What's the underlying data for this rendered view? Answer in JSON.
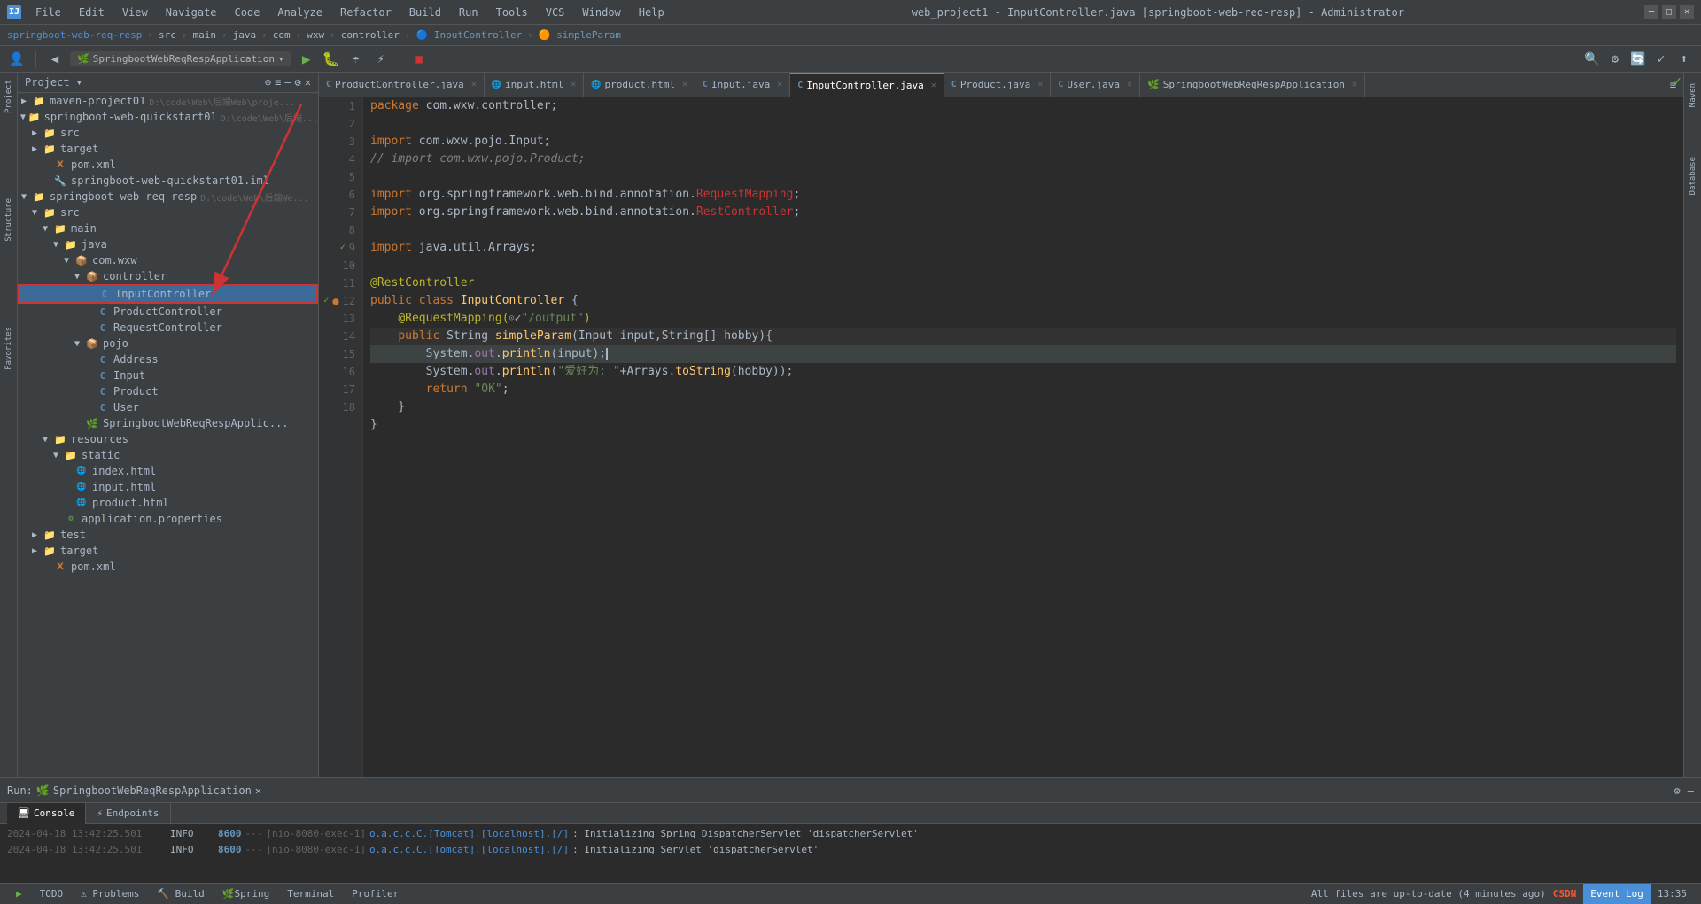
{
  "titlebar": {
    "app_icon": "IJ",
    "title": "web_project1 - InputController.java [springboot-web-req-resp] - Administrator",
    "menu": [
      "File",
      "Edit",
      "View",
      "Navigate",
      "Code",
      "Analyze",
      "Refactor",
      "Build",
      "Run",
      "Tools",
      "VCS",
      "Window",
      "Help"
    ]
  },
  "breadcrumb": {
    "items": [
      "springboot-web-req-resp",
      "src",
      "main",
      "java",
      "com",
      "wxw",
      "controller",
      "InputController",
      "simpleParam"
    ]
  },
  "tabs": [
    {
      "label": "ProductController.java",
      "type": "java",
      "active": false,
      "modified": false
    },
    {
      "label": "input.html",
      "type": "html",
      "active": false,
      "modified": false
    },
    {
      "label": "product.html",
      "type": "html",
      "active": false,
      "modified": false
    },
    {
      "label": "Input.java",
      "type": "java",
      "active": false,
      "modified": false
    },
    {
      "label": "InputController.java",
      "type": "java",
      "active": true,
      "modified": false
    },
    {
      "label": "Product.java",
      "type": "java",
      "active": false,
      "modified": false
    },
    {
      "label": "User.java",
      "type": "java",
      "active": false,
      "modified": false
    },
    {
      "label": "SpringbootWebReqRespApplication",
      "type": "spring",
      "active": false,
      "modified": false
    }
  ],
  "code": {
    "package_line": "package com.wxw.controller;",
    "import1": "import com.wxw.pojo.Input;",
    "import2": "// import com.wxw.pojo.Product;",
    "import3": "import org.springframework.web.bind.annotation.RequestMapping;",
    "import4": "import org.springframework.web.bind.annotation.RestController;",
    "import5": "import java.util.Arrays;",
    "annotation1": "@RestController",
    "class_decl": "public class InputController {",
    "annotation2": "@RequestMapping(",
    "annotation2b": "\"/output\")",
    "method_decl": "    public String simpleParam(Input input,String[] hobby){",
    "line13": "        System.out.println(input);",
    "line14": "        System.out.println(\"爱好为: \"+Arrays.toString(hobby));",
    "line15": "        return \"OK\";",
    "line16": "    }",
    "line17": "}"
  },
  "project_tree": {
    "title": "Project",
    "items": [
      {
        "name": "maven-project01",
        "path": "D:\\code\\Web\\后端Web\\proje...",
        "type": "root",
        "level": 0,
        "expanded": false
      },
      {
        "name": "springboot-web-quickstart01",
        "path": "D:\\code\\Web\\后端...",
        "type": "root",
        "level": 0,
        "expanded": true
      },
      {
        "name": "src",
        "type": "folder",
        "level": 1,
        "expanded": false
      },
      {
        "name": "target",
        "type": "folder",
        "level": 1,
        "expanded": false
      },
      {
        "name": "pom.xml",
        "type": "xml",
        "level": 1
      },
      {
        "name": "springboot-web-quickstart01.iml",
        "type": "iml",
        "level": 1
      },
      {
        "name": "springboot-web-req-resp",
        "path": "D:\\code\\Web\\后端We...",
        "type": "root",
        "level": 0,
        "expanded": true
      },
      {
        "name": "src",
        "type": "folder",
        "level": 1,
        "expanded": true
      },
      {
        "name": "main",
        "type": "folder",
        "level": 2,
        "expanded": true
      },
      {
        "name": "java",
        "type": "folder",
        "level": 3,
        "expanded": true
      },
      {
        "name": "com.wxw",
        "type": "package",
        "level": 4,
        "expanded": true
      },
      {
        "name": "controller",
        "type": "package",
        "level": 5,
        "expanded": true
      },
      {
        "name": "InputController",
        "type": "java-class",
        "level": 6,
        "selected": true,
        "highlighted": true
      },
      {
        "name": "ProductController",
        "type": "java-class",
        "level": 6
      },
      {
        "name": "RequestController",
        "type": "java-class",
        "level": 6
      },
      {
        "name": "pojo",
        "type": "package",
        "level": 5,
        "expanded": true
      },
      {
        "name": "Address",
        "type": "java-class",
        "level": 6
      },
      {
        "name": "Input",
        "type": "java-class",
        "level": 6
      },
      {
        "name": "Product",
        "type": "java-class",
        "level": 6
      },
      {
        "name": "User",
        "type": "java-class",
        "level": 6
      },
      {
        "name": "SpringbootWebReqRespApplic...",
        "type": "java-spring",
        "level": 5
      },
      {
        "name": "resources",
        "type": "folder",
        "level": 2,
        "expanded": true
      },
      {
        "name": "static",
        "type": "folder",
        "level": 3,
        "expanded": true
      },
      {
        "name": "index.html",
        "type": "html",
        "level": 4
      },
      {
        "name": "input.html",
        "type": "html",
        "level": 4
      },
      {
        "name": "product.html",
        "type": "html",
        "level": 4
      },
      {
        "name": "application.properties",
        "type": "props",
        "level": 3
      },
      {
        "name": "test",
        "type": "folder",
        "level": 1,
        "expanded": false
      },
      {
        "name": "target",
        "type": "folder",
        "level": 1,
        "expanded": false
      },
      {
        "name": "pom.xml",
        "type": "xml",
        "level": 1
      }
    ]
  },
  "run_panel": {
    "title": "Run:",
    "app_name": "SpringbootWebReqRespApplication",
    "tabs": [
      "Console",
      "Endpoints"
    ],
    "active_tab": "Console",
    "logs": [
      {
        "time": "2024-04-18 13:42:25.501",
        "level": "INFO",
        "port": "8600",
        "dash": "---",
        "thread": "[nio-8080-exec-1]",
        "class": "o.a.c.c.C.[Tomcat].[localhost].[/]",
        "msg": ": Initializing Spring DispatcherServlet 'dispatcherServlet'"
      },
      {
        "time": "2024-04-18 13:42:25.501",
        "level": "INFO",
        "port": "8600",
        "dash": "---",
        "thread": "[nio-8080-exec-1]",
        "class": "o.a.c.c.C.[Tomcat].[localhost].[/]",
        "msg": ": Initializing Servlet 'dispatcherServlet'"
      }
    ]
  },
  "bottom_status": {
    "run_icon": "▶",
    "todo": "TODO",
    "problems": "Problems",
    "build": "Build",
    "spring": "Spring",
    "terminal": "Terminal",
    "profiler": "Profiler",
    "status_msg": "All files are up-to-date (4 minutes ago)",
    "time": "13:35",
    "csdn": "CSDN",
    "event_log": "Event Log",
    "line_col": "13:35"
  },
  "run_config": {
    "label": "SpringbootWebReqRespApplication"
  },
  "colors": {
    "accent": "#4a90d9",
    "bg_dark": "#2b2b2b",
    "bg_panel": "#3c3f41",
    "success": "#6aaf50",
    "error": "#cc3333",
    "keyword": "#cc7832",
    "string": "#6a8759",
    "annotation": "#bbb529",
    "class_color": "#ffc66d"
  }
}
